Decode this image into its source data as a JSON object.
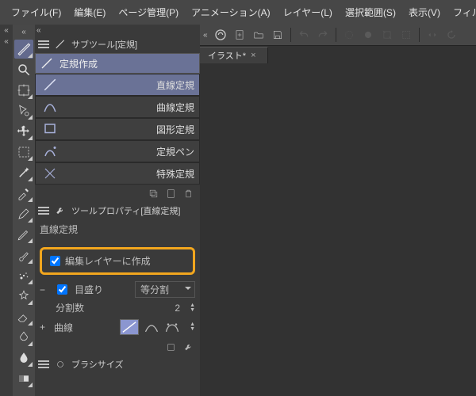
{
  "menu": {
    "file": "ファイル(F)",
    "edit": "編集(E)",
    "page": "ページ管理(P)",
    "anim": "アニメーション(A)",
    "layer": "レイヤー(L)",
    "select": "選択範囲(S)",
    "view": "表示(V)",
    "filter": "フィルター(I)"
  },
  "subtool_panel": {
    "title": "サブツール[定規]",
    "group": "定規作成",
    "items": [
      "直線定規",
      "曲線定規",
      "図形定規",
      "定規ペン",
      "特殊定規"
    ]
  },
  "toolprop_panel": {
    "title": "ツールプロパティ[直線定規]",
    "heading": "直線定規",
    "edit_layer": "編集レイヤーに作成",
    "scale_label": "目盛り",
    "scale_mode": "等分割",
    "division_label": "分割数",
    "division_value": "2",
    "curve_label": "曲線"
  },
  "brush_panel": {
    "title": "ブラシサイズ"
  },
  "document_tab": "イラスト*"
}
